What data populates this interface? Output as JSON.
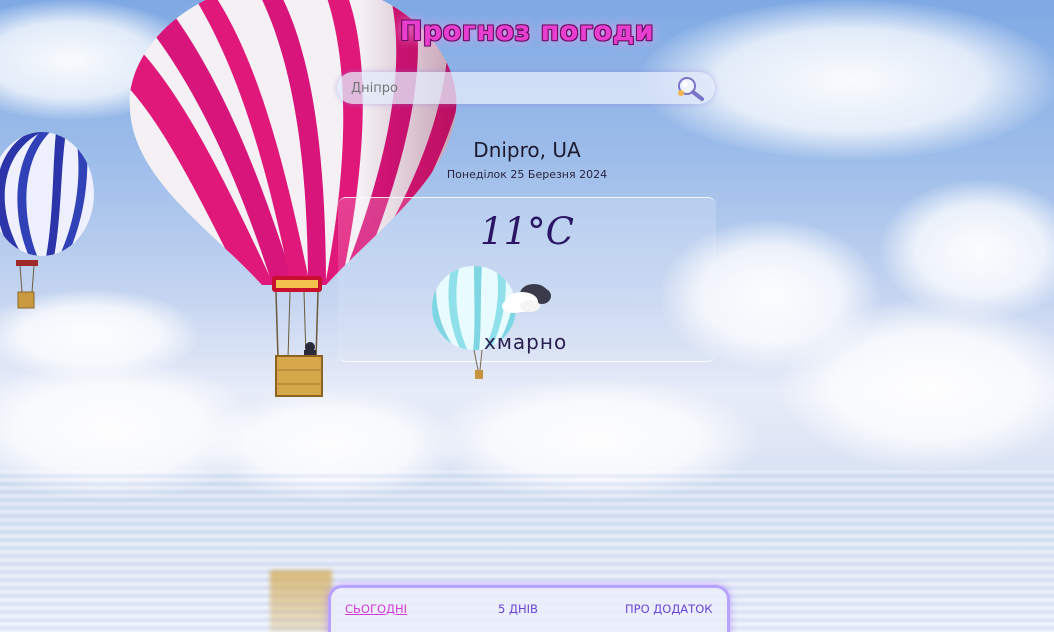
{
  "app": {
    "title": "Прогноз погоди"
  },
  "search": {
    "value": "Дніпро",
    "placeholder": "Дніпро"
  },
  "location": {
    "city": "Dnipro, UA",
    "date": "Понеділок 25 Березня 2024"
  },
  "weather": {
    "temperature": "11°C",
    "description": "хмарно",
    "icon": "cloudy-icon"
  },
  "nav": {
    "items": [
      {
        "label": "СЬОГОДНІ",
        "active": true
      },
      {
        "label": "5 ДНІВ",
        "active": false
      },
      {
        "label": "ПРО ДОДАТОК",
        "active": false
      }
    ]
  },
  "colors": {
    "title": "#e93fd0",
    "accent": "#b8a2ff",
    "nav_active": "#d23ad7",
    "nav_text": "#6a44d6",
    "temperature": "#2a1464"
  }
}
